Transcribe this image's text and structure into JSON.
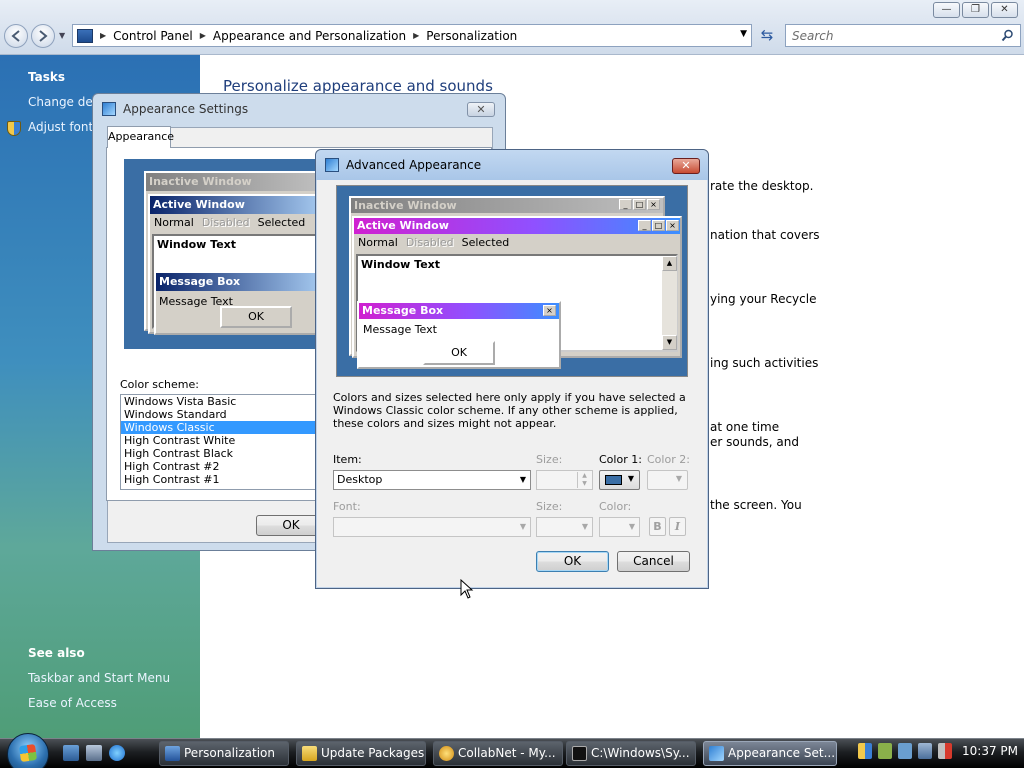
{
  "explorer": {
    "breadcrumb": [
      "Control Panel",
      "Appearance and Personalization",
      "Personalization"
    ],
    "search_placeholder": "Search",
    "window_controls": [
      "—",
      "❐",
      "✕"
    ]
  },
  "left_pane": {
    "tasks_heading": "Tasks",
    "task_links": [
      "Change desk",
      "Adjust font s"
    ],
    "see_also_heading": "See also",
    "see_also_links": [
      "Taskbar and Start Menu",
      "Ease of Access"
    ]
  },
  "main": {
    "title": "Personalize appearance and sounds",
    "fragments": [
      "rate the desktop.",
      "nation that covers",
      "ying your Recycle",
      "ing such activities",
      "at one time",
      "er sounds, and",
      "the screen. You"
    ]
  },
  "appearance_settings": {
    "title": "Appearance Settings",
    "tab": "Appearance",
    "preview": {
      "inactive_title": "Inactive Window",
      "active_title": "Active Window",
      "menu": [
        "Normal",
        "Disabled",
        "Selected"
      ],
      "window_text": "Window Text",
      "message_box_title": "Message Box",
      "message_text": "Message Text",
      "ok": "OK"
    },
    "color_scheme_label": "Color scheme:",
    "schemes": [
      "Windows Vista Basic",
      "Windows Standard",
      "Windows Classic",
      "High Contrast White",
      "High Contrast Black",
      "High Contrast #2",
      "High Contrast #1"
    ],
    "selected_scheme": "Windows Classic",
    "ok_button": "OK"
  },
  "advanced_appearance": {
    "title": "Advanced Appearance",
    "preview": {
      "inactive_title": "Inactive Window",
      "active_title": "Active Window",
      "menu": [
        "Normal",
        "Disabled",
        "Selected"
      ],
      "window_text": "Window Text",
      "message_box_title": "Message Box",
      "message_text": "Message Text",
      "ok": "OK"
    },
    "info": "Colors and sizes selected here only apply if you have selected a Windows Classic color scheme. If any other scheme is applied, these colors and sizes might not appear.",
    "item_label": "Item:",
    "item_value": "Desktop",
    "size_label": "Size:",
    "color1_label": "Color 1:",
    "color2_label": "Color 2:",
    "font_label": "Font:",
    "font_size_label": "Size:",
    "font_color_label": "Color:",
    "bold_label": "B",
    "italic_label": "I",
    "color1_value": "#3A6EA5",
    "ok_button": "OK",
    "cancel_button": "Cancel"
  },
  "taskbar": {
    "buttons": [
      "Personalization",
      "Update Packages",
      "CollabNet - My...",
      "C:\\Windows\\Sy...",
      "Appearance Set..."
    ],
    "active_button": "Appearance Set...",
    "clock": "10:37 PM"
  }
}
